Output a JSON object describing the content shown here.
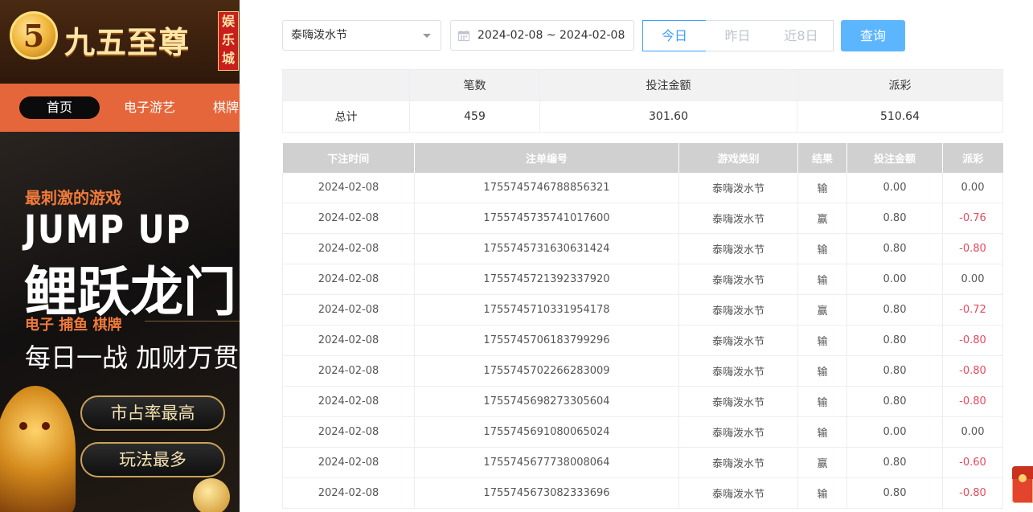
{
  "site": {
    "logo_mark": "5",
    "logo_text": "九五至尊",
    "logo_badge": "娱乐城",
    "nav": [
      "首页",
      "电子游艺",
      "棋牌"
    ],
    "promo": {
      "headline": "最刺激的游戏",
      "jump": "JUMP UP",
      "big": "鲤跃龙门",
      "cats": "电子  捕鱼  棋牌",
      "slogan": "每日一战  加财万贯",
      "pill1": "市占率最高",
      "pill2": "玩法最多"
    }
  },
  "filters": {
    "game": "泰嗨泼水节",
    "date_range": "2024-02-08 ~ 2024-02-08",
    "quick": [
      "今日",
      "昨日",
      "近8日"
    ],
    "query": "查询"
  },
  "summary": {
    "headers": [
      "",
      "笔数",
      "投注金额",
      "派彩"
    ],
    "row": [
      "总计",
      "459",
      "301.60",
      "510.64"
    ]
  },
  "records": {
    "headers": [
      "下注时间",
      "注单编号",
      "游戏类别",
      "结果",
      "投注金额",
      "派彩"
    ],
    "rows": [
      [
        "2024-02-08",
        "1755745746788856321",
        "泰嗨泼水节",
        "输",
        "0.00",
        "0.00"
      ],
      [
        "2024-02-08",
        "1755745735741017600",
        "泰嗨泼水节",
        "赢",
        "0.80",
        "-0.76"
      ],
      [
        "2024-02-08",
        "1755745731630631424",
        "泰嗨泼水节",
        "输",
        "0.80",
        "-0.80"
      ],
      [
        "2024-02-08",
        "1755745721392337920",
        "泰嗨泼水节",
        "输",
        "0.00",
        "0.00"
      ],
      [
        "2024-02-08",
        "1755745710331954178",
        "泰嗨泼水节",
        "赢",
        "0.80",
        "-0.72"
      ],
      [
        "2024-02-08",
        "1755745706183799296",
        "泰嗨泼水节",
        "输",
        "0.80",
        "-0.80"
      ],
      [
        "2024-02-08",
        "1755745702266283009",
        "泰嗨泼水节",
        "输",
        "0.80",
        "-0.80"
      ],
      [
        "2024-02-08",
        "1755745698273305604",
        "泰嗨泼水节",
        "输",
        "0.80",
        "-0.80"
      ],
      [
        "2024-02-08",
        "1755745691080065024",
        "泰嗨泼水节",
        "输",
        "0.00",
        "0.00"
      ],
      [
        "2024-02-08",
        "1755745677738008064",
        "泰嗨泼水节",
        "赢",
        "0.80",
        "-0.60"
      ],
      [
        "2024-02-08",
        "1755745673082333696",
        "泰嗨泼水节",
        "输",
        "0.80",
        "-0.80"
      ]
    ]
  },
  "colors": {
    "accent": "#409eff",
    "query_button": "#5cb6ff",
    "negative": "#e8475b",
    "nav_bar": "#e5663b"
  }
}
